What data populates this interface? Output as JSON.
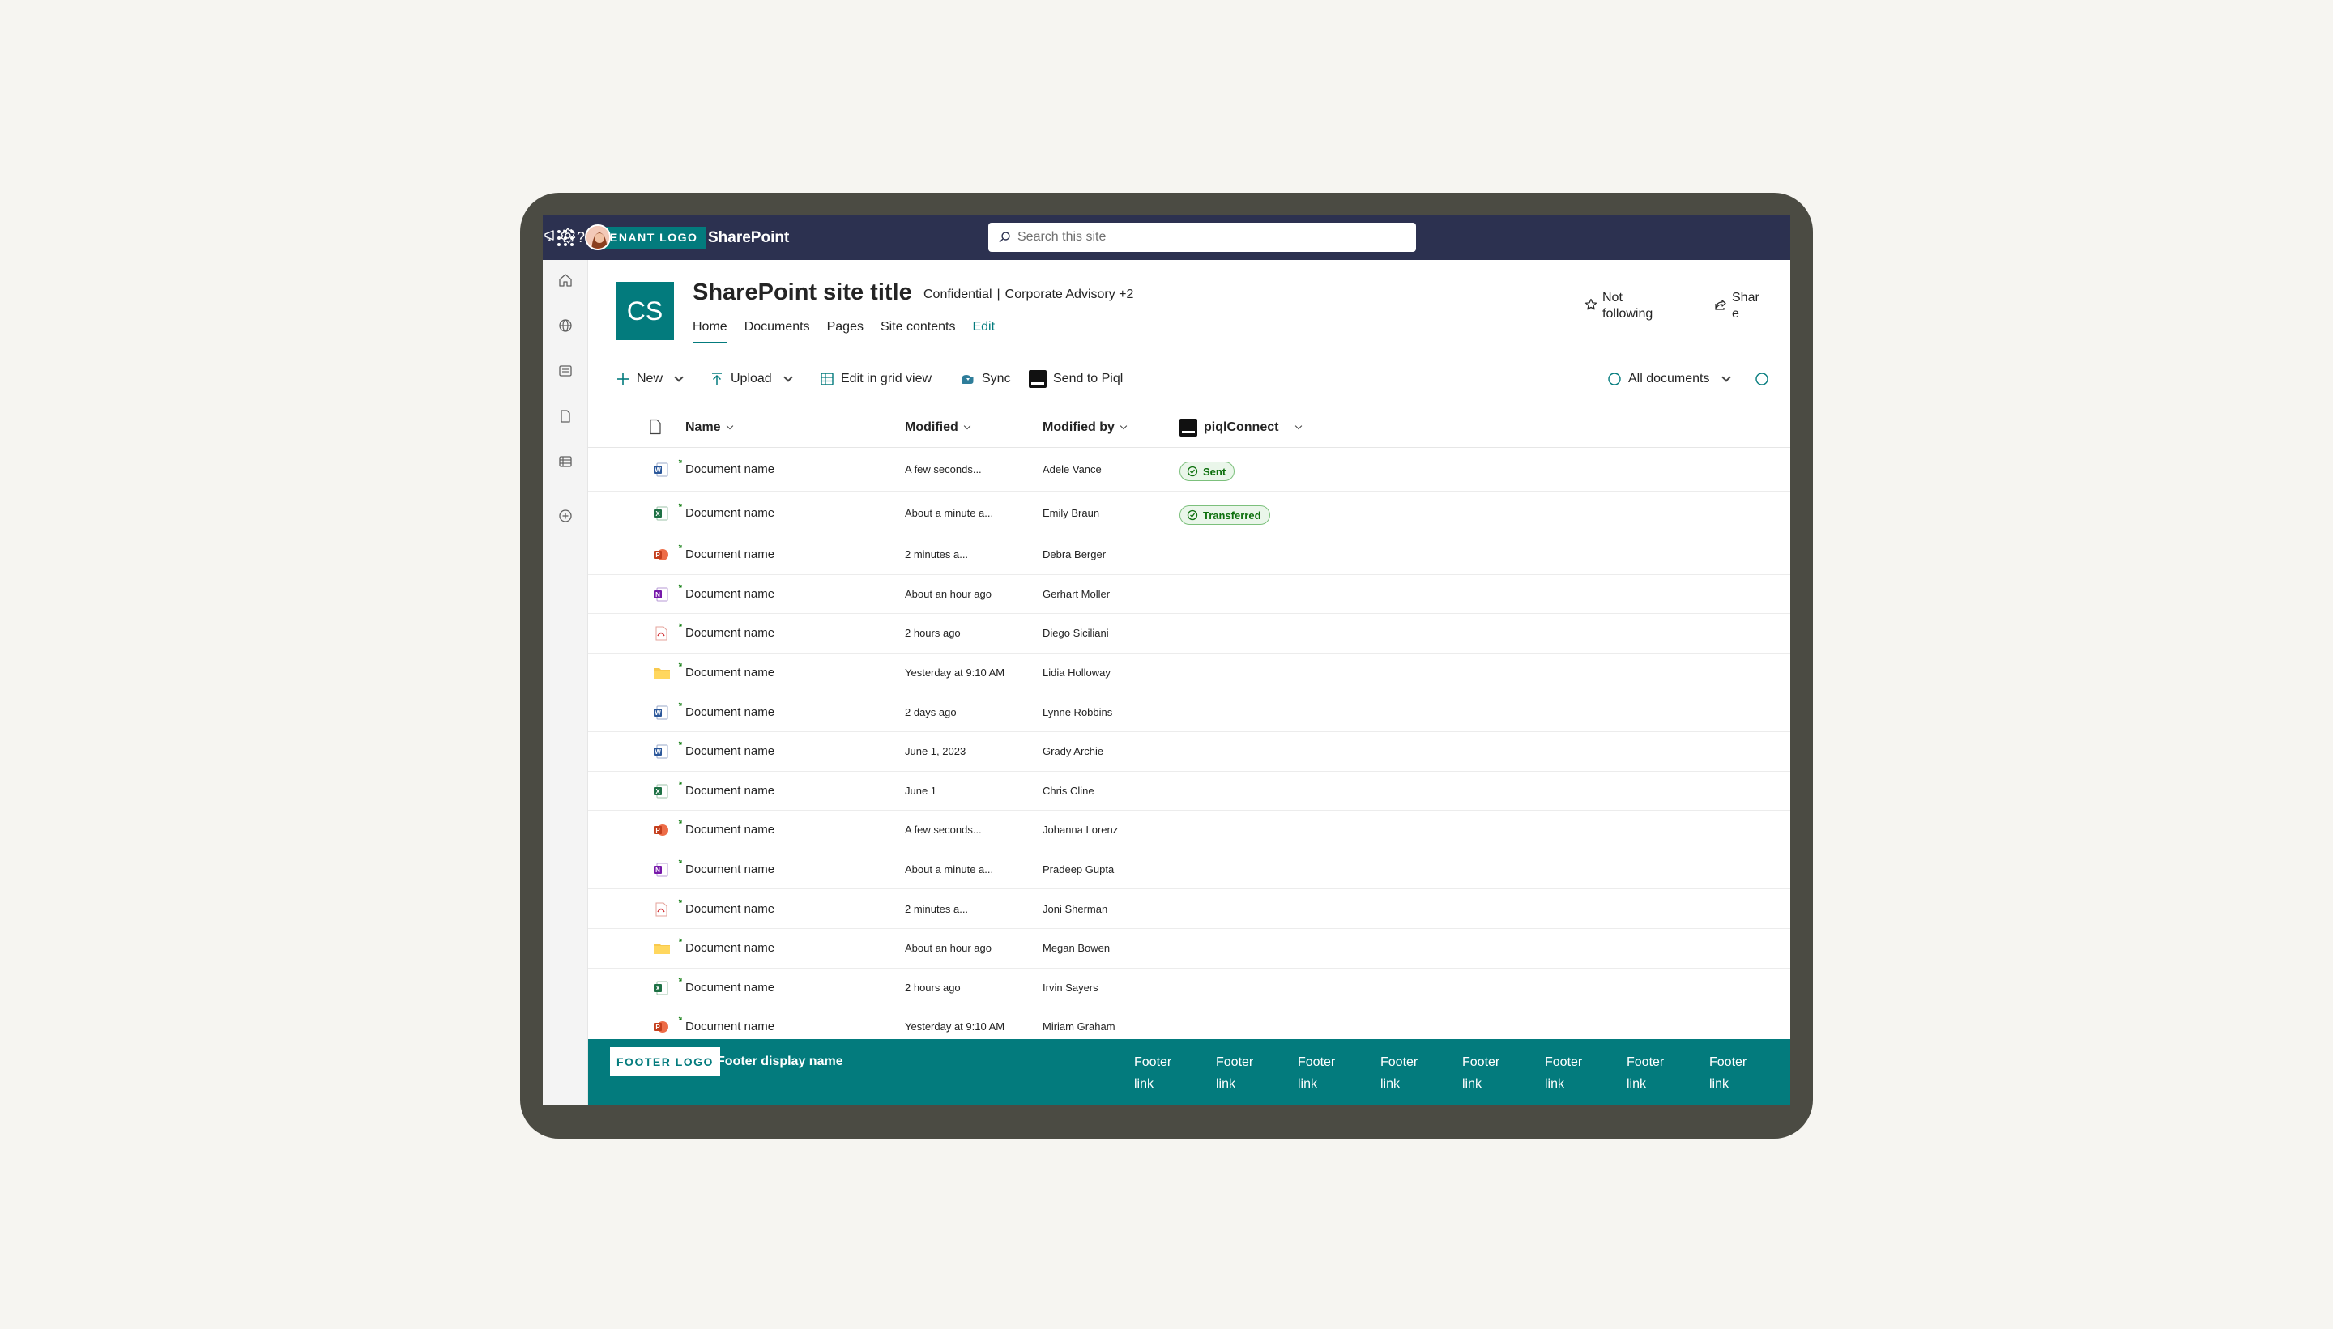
{
  "suite_bar": {
    "tenant_logo": "TENANT LOGO",
    "app_name": "SharePoint",
    "search_placeholder": "Search this site",
    "icons": [
      "waffle-icon",
      "megaphone-icon",
      "settings-gear-icon",
      "help-icon",
      "avatar"
    ]
  },
  "left_rail": {
    "icons": [
      "home-icon",
      "globe-icon",
      "news-icon",
      "file-icon",
      "list-icon",
      "add-icon"
    ]
  },
  "site": {
    "logo_initials": "CS",
    "title": "SharePoint site title",
    "classification": "Confidential",
    "group": "Corporate Advisory +2",
    "nav": [
      "Home",
      "Documents",
      "Pages",
      "Site contents"
    ],
    "edit_label": "Edit",
    "follow_label": "Not following",
    "share_label": "Share"
  },
  "command_bar": {
    "new_label": "New",
    "upload_label": "Upload",
    "grid_label": "Edit in grid view",
    "sync_label": "Sync",
    "send_label": "Send to Piql",
    "view_label": "All documents"
  },
  "table": {
    "headers": {
      "name": "Name",
      "modified": "Modified",
      "modified_by": "Modified by",
      "piql": "piqlConnect"
    },
    "rows": [
      {
        "type": "word",
        "name": "Document name",
        "modified": "A few seconds...",
        "modified_by": "Adele Vance",
        "status": "Sent"
      },
      {
        "type": "excel",
        "name": "Document name",
        "modified": "About a minute a...",
        "modified_by": "Emily Braun",
        "status": "Transferred"
      },
      {
        "type": "ppt",
        "name": "Document name",
        "modified": "2 minutes a...",
        "modified_by": "Debra Berger",
        "status": ""
      },
      {
        "type": "onenote",
        "name": "Document name",
        "modified": "About an hour ago",
        "modified_by": "Gerhart Moller",
        "status": ""
      },
      {
        "type": "pdf",
        "name": "Document name",
        "modified": "2 hours ago",
        "modified_by": "Diego Siciliani",
        "status": ""
      },
      {
        "type": "folder",
        "name": "Document name",
        "modified": "Yesterday at 9:10 AM",
        "modified_by": "Lidia Holloway",
        "status": ""
      },
      {
        "type": "word",
        "name": "Document name",
        "modified": "2 days ago",
        "modified_by": "Lynne Robbins",
        "status": ""
      },
      {
        "type": "word",
        "name": "Document name",
        "modified": "June 1, 2023",
        "modified_by": "Grady Archie",
        "status": ""
      },
      {
        "type": "excel",
        "name": "Document name",
        "modified": "June 1",
        "modified_by": "Chris Cline",
        "status": ""
      },
      {
        "type": "ppt",
        "name": "Document name",
        "modified": "A few seconds...",
        "modified_by": "Johanna Lorenz",
        "status": ""
      },
      {
        "type": "onenote",
        "name": "Document name",
        "modified": "About a minute a...",
        "modified_by": "Pradeep Gupta",
        "status": ""
      },
      {
        "type": "pdf",
        "name": "Document name",
        "modified": "2 minutes a...",
        "modified_by": "Joni Sherman",
        "status": ""
      },
      {
        "type": "folder",
        "name": "Document name",
        "modified": "About an hour ago",
        "modified_by": "Megan Bowen",
        "status": ""
      },
      {
        "type": "excel",
        "name": "Document name",
        "modified": "2 hours ago",
        "modified_by": "Irvin Sayers",
        "status": ""
      },
      {
        "type": "ppt",
        "name": "Document name",
        "modified": "Yesterday at 9:10 AM",
        "modified_by": "Miriam Graham",
        "status": ""
      }
    ]
  },
  "footer": {
    "logo": "FOOTER LOGO",
    "display_name": "Footer display name",
    "links": [
      "Footer link",
      "Footer link",
      "Footer link",
      "Footer link",
      "Footer link",
      "Footer link",
      "Footer link",
      "Footer link"
    ]
  },
  "colors": {
    "suite_bar": "#2c3150",
    "brand_teal": "#037b7d",
    "device_frame": "#4b4b43",
    "page_bg": "#f6f5f1",
    "badge_green": "#0e700e"
  }
}
